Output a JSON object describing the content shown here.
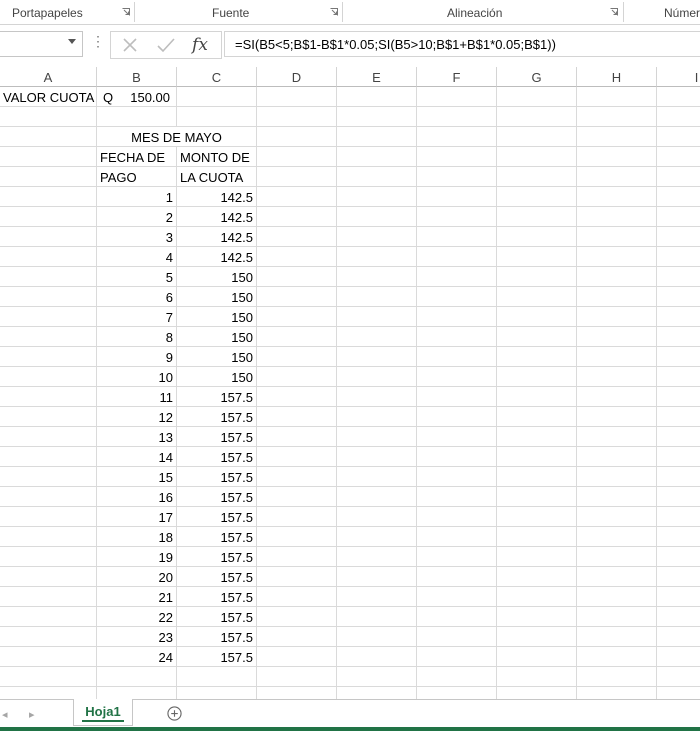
{
  "ribbon": {
    "groups": [
      "Portapapeles",
      "Fuente",
      "Alineación",
      "Número"
    ]
  },
  "formula_bar": {
    "name_box": "",
    "formula": "=SI(B5<5;B$1-B$1*0.05;SI(B5>10;B$1+B$1*0.05;B$1))"
  },
  "columns": [
    "A",
    "B",
    "C",
    "D",
    "E",
    "F",
    "G",
    "H",
    "I"
  ],
  "cells": {
    "a1": "VALOR CUOTA",
    "b1_currency": "Q",
    "b1_value": "150.00",
    "bc3": "MES DE MAYO",
    "b4": "FECHA DE",
    "c4": "MONTO DE",
    "b5": "PAGO",
    "c5": "LA CUOTA"
  },
  "payments": [
    {
      "day": "1",
      "amount": "142.5"
    },
    {
      "day": "2",
      "amount": "142.5"
    },
    {
      "day": "3",
      "amount": "142.5"
    },
    {
      "day": "4",
      "amount": "142.5"
    },
    {
      "day": "5",
      "amount": "150"
    },
    {
      "day": "6",
      "amount": "150"
    },
    {
      "day": "7",
      "amount": "150"
    },
    {
      "day": "8",
      "amount": "150"
    },
    {
      "day": "9",
      "amount": "150"
    },
    {
      "day": "10",
      "amount": "150"
    },
    {
      "day": "11",
      "amount": "157.5"
    },
    {
      "day": "12",
      "amount": "157.5"
    },
    {
      "day": "13",
      "amount": "157.5"
    },
    {
      "day": "14",
      "amount": "157.5"
    },
    {
      "day": "15",
      "amount": "157.5"
    },
    {
      "day": "16",
      "amount": "157.5"
    },
    {
      "day": "17",
      "amount": "157.5"
    },
    {
      "day": "18",
      "amount": "157.5"
    },
    {
      "day": "19",
      "amount": "157.5"
    },
    {
      "day": "20",
      "amount": "157.5"
    },
    {
      "day": "21",
      "amount": "157.5"
    },
    {
      "day": "22",
      "amount": "157.5"
    },
    {
      "day": "23",
      "amount": "157.5"
    },
    {
      "day": "24",
      "amount": "157.5"
    }
  ],
  "sheets": [
    {
      "label": "Hoja1",
      "active": true
    }
  ],
  "icons": {
    "launcher": "dialog-launcher-icon",
    "cancel": "cancel-x-icon",
    "enter": "enter-check-icon",
    "insert_function": "fx-icon",
    "add_sheet": "add-sheet-icon"
  },
  "colors": {
    "excel_green": "#217346",
    "gridline": "#dadada"
  }
}
